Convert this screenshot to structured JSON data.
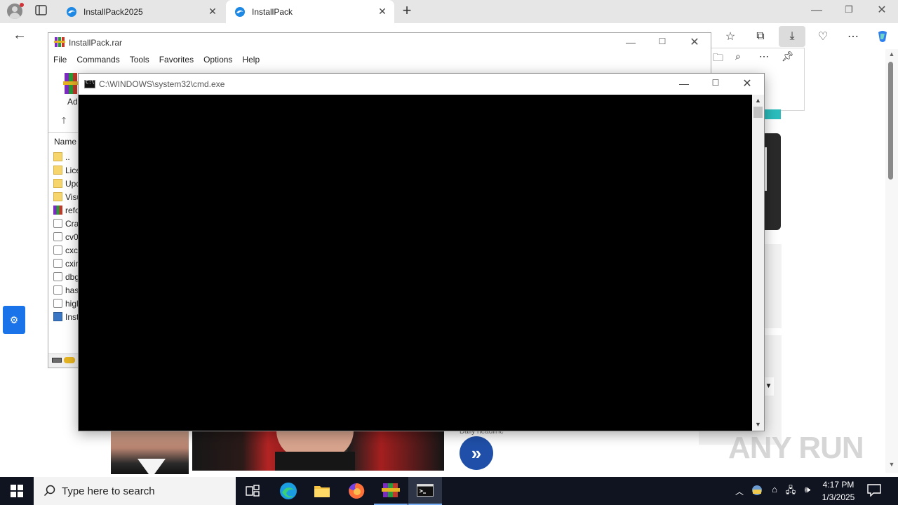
{
  "browser": {
    "tabs": [
      {
        "label": "InstallPack2025",
        "active": false
      },
      {
        "label": "InstallPack",
        "active": true
      }
    ],
    "new_tab_label": "+"
  },
  "webpage": {
    "headline_label": "Daily headline"
  },
  "winrar": {
    "title": "InstallPack.rar",
    "menu": [
      "File",
      "Commands",
      "Tools",
      "Favorites",
      "Options",
      "Help"
    ],
    "toolbar_add_label": "Ad",
    "list_header": "Name",
    "rows": [
      {
        "name": "..",
        "type": "folder"
      },
      {
        "name": "Lice",
        "type": "folder"
      },
      {
        "name": "Upd",
        "type": "folder"
      },
      {
        "name": "Visu",
        "type": "folder"
      },
      {
        "name": "refo",
        "type": "rar"
      },
      {
        "name": "Cra",
        "type": "file"
      },
      {
        "name": "cv0",
        "type": "file"
      },
      {
        "name": "cxc",
        "type": "file"
      },
      {
        "name": "cxir",
        "type": "file"
      },
      {
        "name": "dbg",
        "type": "file"
      },
      {
        "name": "has",
        "type": "file"
      },
      {
        "name": "higl",
        "type": "file"
      },
      {
        "name": "Inst",
        "type": "app"
      }
    ]
  },
  "cmd": {
    "title": "C:\\WINDOWS\\system32\\cmd.exe",
    "console_bg": "#000000"
  },
  "taskbar": {
    "search_placeholder": "Type here to search",
    "time": "4:17 PM",
    "date": "1/3/2025"
  },
  "watermark": "ANY RUN",
  "colors": {
    "accent": "#1a73e8",
    "taskbar": "#101420"
  }
}
